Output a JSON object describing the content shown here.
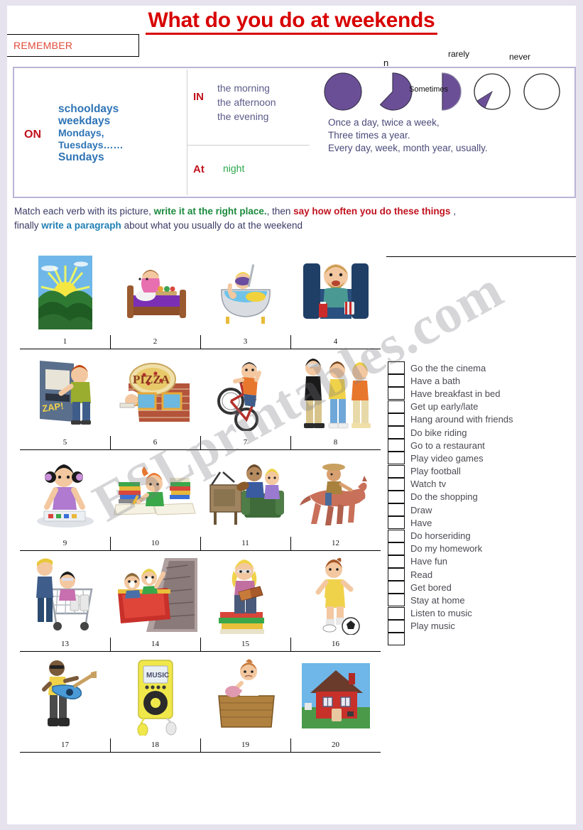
{
  "title": "What do you do at weekends",
  "remember": {
    "label": "REMEMBER"
  },
  "watermark": "ESLprintables.com",
  "frequency_scale": {
    "labels": [
      {
        "name": "often-partial",
        "text": "n"
      },
      {
        "name": "rarely",
        "text": "rarely"
      },
      {
        "name": "never",
        "text": "never"
      },
      {
        "name": "sometimes",
        "text": "Sometimes"
      }
    ],
    "sentences": [
      "Once a  day, twice a week,",
      "Three times a year.",
      "Every day, week, month year, usually."
    ],
    "colors": {
      "pie_fill": "#6b4f96",
      "pie_stroke": "#2b2b2b"
    }
  },
  "prepositions_table": {
    "on": {
      "preposition": "ON",
      "lines": [
        "schooldays",
        "weekdays",
        "Mondays,",
        "Tuesdays……",
        "Sundays"
      ]
    },
    "in": {
      "preposition": "IN",
      "lines": [
        "the morning",
        "the afternoon",
        "the evening"
      ]
    },
    "at": {
      "preposition": "At",
      "lines": [
        "night"
      ]
    },
    "colors": {
      "preposition": "#c1121f",
      "days": "#2e74b5",
      "times": "#5b5b8a",
      "night": "#2aa84a"
    }
  },
  "instructions": {
    "part1": "Match each verb with its picture, ",
    "part2_green": "write it at the right place.",
    "part3": ", then ",
    "part4_red": "say how often you do these things",
    "part5": " ,",
    "line2_part1": "finally ",
    "line2_blue": "write a paragraph",
    "line2_part2": " about what you usually do at the weekend"
  },
  "picture_grid": {
    "rows": [
      [
        {
          "num": "1",
          "art": "sunrise-over-hills"
        },
        {
          "num": "2",
          "art": "girl-breakfast-in-bed"
        },
        {
          "num": "3",
          "art": "boy-in-bathtub-snorkel"
        },
        {
          "num": "4",
          "art": "man-at-cinema-seat"
        }
      ],
      [
        {
          "num": "5",
          "art": "boy-arcade-video-game"
        },
        {
          "num": "6",
          "art": "pizza-restaurant"
        },
        {
          "num": "7",
          "art": "boy-on-bike"
        },
        {
          "num": "8",
          "art": "teens-hanging-out"
        }
      ],
      [
        {
          "num": "9",
          "art": "girl-painting-drawing"
        },
        {
          "num": "10",
          "art": "girl-doing-homework"
        },
        {
          "num": "11",
          "art": "kids-watching-tv"
        },
        {
          "num": "12",
          "art": "girl-horseriding"
        }
      ],
      [
        {
          "num": "13",
          "art": "shopping-trolley"
        },
        {
          "num": "14",
          "art": "rollercoaster-fun"
        },
        {
          "num": "15",
          "art": "girl-reading-on-books"
        },
        {
          "num": "16",
          "art": "girl-playing-football"
        }
      ],
      [
        {
          "num": "17",
          "art": "man-playing-guitar"
        },
        {
          "num": "18",
          "art": "mp3-music-player"
        },
        {
          "num": "19",
          "art": "bored-girl-at-desk"
        },
        {
          "num": "20",
          "art": "red-house"
        }
      ]
    ]
  },
  "verb_list": {
    "items": [
      "Go the the cinema",
      "Have a bath",
      "Have breakfast in bed",
      "Get up early/late",
      "Hang around with friends",
      "Do bike riding",
      "Go to a restaurant",
      "Play video games",
      "Play football",
      "Watch tv",
      "Do the shopping",
      "Draw",
      "Have",
      "Do horseriding",
      "Do my homework",
      "Have fun",
      "Read",
      "Get bored",
      "Stay at home",
      "Listen to music",
      "Play music",
      ""
    ]
  }
}
